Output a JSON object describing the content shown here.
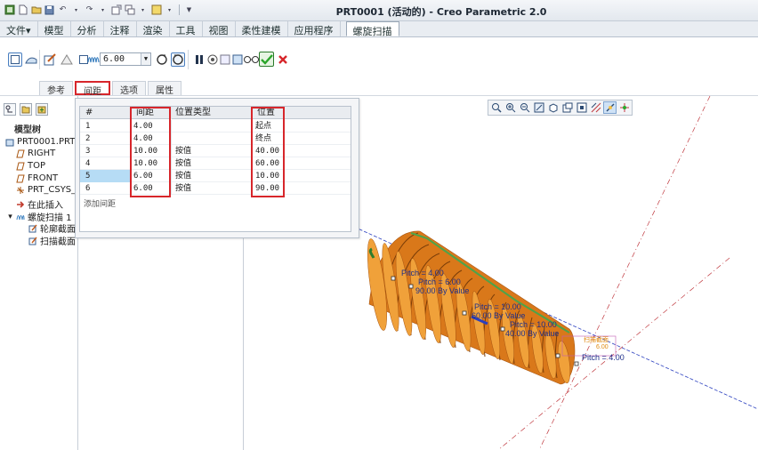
{
  "titlebar": {
    "title": "PRT0001 (活动的) - Creo Parametric 2.0"
  },
  "menu": {
    "tabs": [
      "文件▾",
      "模型",
      "分析",
      "注释",
      "渲染",
      "工具",
      "视图",
      "柔性建模",
      "应用程序"
    ],
    "active_tab": "螺旋扫描"
  },
  "ribbon": {
    "pitch_value": "6.00",
    "subtabs": [
      "参考",
      "间距",
      "选项",
      "属性"
    ],
    "active_subtab": "间距"
  },
  "model_tree": {
    "title": "模型树",
    "items": [
      {
        "label": "PRT0001.PRT",
        "icon": "part-icon"
      },
      {
        "label": "RIGHT",
        "icon": "datum-plane-icon"
      },
      {
        "label": "TOP",
        "icon": "datum-plane-icon"
      },
      {
        "label": "FRONT",
        "icon": "datum-plane-icon"
      },
      {
        "label": "PRT_CSYS_",
        "icon": "csys-icon"
      },
      {
        "label": "在此插入",
        "icon": "insert-arrow-icon"
      },
      {
        "label": "螺旋扫描 1",
        "icon": "helical-sweep-icon"
      },
      {
        "label": "轮廓截面",
        "icon": "sketch-icon"
      },
      {
        "label": "扫描截面",
        "icon": "sketch-icon"
      }
    ]
  },
  "spacing_table": {
    "headers": {
      "num": "#",
      "pitch": "间距",
      "type": "位置类型",
      "position": "位置"
    },
    "rows": [
      {
        "num": "1",
        "pitch": "4.00",
        "type": "",
        "position": "起点"
      },
      {
        "num": "2",
        "pitch": "4.00",
        "type": "",
        "position": "终点"
      },
      {
        "num": "3",
        "pitch": "10.00",
        "type": "按值",
        "position": "40.00"
      },
      {
        "num": "4",
        "pitch": "10.00",
        "type": "按值",
        "position": "60.00"
      },
      {
        "num": "5",
        "pitch": "6.00",
        "type": "按值",
        "position": "10.00"
      },
      {
        "num": "6",
        "pitch": "6.00",
        "type": "按值",
        "position": "90.00"
      }
    ],
    "selected_row": "5",
    "add_label": "添加间距"
  },
  "graphics": {
    "annotations": {
      "a1": "Pitch = 4.00",
      "a2": "Pitch = 6.00",
      "a3": "90.00 By Value",
      "a4": "Pitch = 10.00",
      "a5": "60.00 By Value",
      "a6": "Pitch = 10.00",
      "a7": "40.00 By Value",
      "a8": "Pitch = 4.00"
    },
    "colors": {
      "spring": "#e8891a",
      "spring_dark": "#a85510",
      "axis_red": "#c0393f",
      "axis_blue": "#2a3fbf",
      "highlight_red": "#d7262b",
      "confirm_green": "#2aa52a"
    }
  }
}
